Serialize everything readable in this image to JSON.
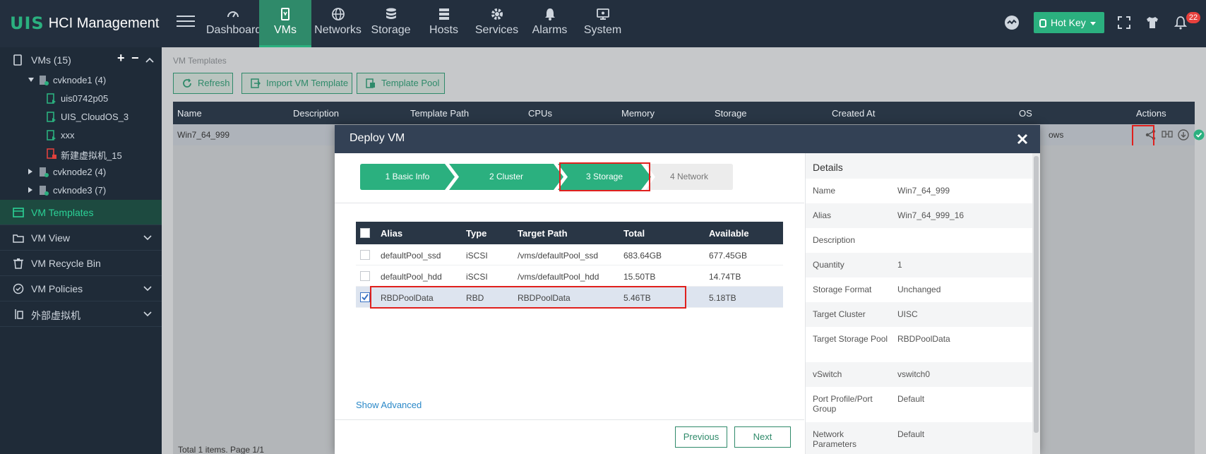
{
  "app": {
    "logo_mark": "UIS",
    "title": "HCI Management"
  },
  "nav": [
    {
      "label": "Dashboard",
      "icon": "gauge-icon"
    },
    {
      "label": "VMs",
      "icon": "vm-icon",
      "active": true
    },
    {
      "label": "Networks",
      "icon": "globe-icon"
    },
    {
      "label": "Storage",
      "icon": "database-icon"
    },
    {
      "label": "Hosts",
      "icon": "server-icon"
    },
    {
      "label": "Services",
      "icon": "gear-icon"
    },
    {
      "label": "Alarms",
      "icon": "bell-icon"
    },
    {
      "label": "System",
      "icon": "monitor-icon"
    }
  ],
  "topright": {
    "hotkey": "Hot Key",
    "notifications": "22"
  },
  "sidebar": {
    "head": "VMs (15)",
    "tree": [
      {
        "label": "cvknode1 (4)",
        "type": "host"
      },
      {
        "label": "uis0742p05",
        "type": "vm-running"
      },
      {
        "label": "UIS_CloudOS_3",
        "type": "vm-running"
      },
      {
        "label": "xxx",
        "type": "vm-running"
      },
      {
        "label": "新建虚拟机_15",
        "type": "vm-stopped"
      },
      {
        "label": "cvknode2 (4)",
        "type": "host"
      },
      {
        "label": "cvknode3 (7)",
        "type": "host"
      }
    ],
    "sections": [
      {
        "label": "VM Templates",
        "active": true
      },
      {
        "label": "VM View"
      },
      {
        "label": "VM Recycle Bin"
      },
      {
        "label": "VM Policies"
      },
      {
        "label": "外部虚拟机"
      }
    ]
  },
  "content": {
    "breadcrumb": "VM Templates",
    "toolbar": {
      "refresh": "Refresh",
      "import": "Import VM Template",
      "pool": "Template Pool"
    },
    "columns": [
      "Name",
      "Description",
      "Template Path",
      "CPUs",
      "Memory",
      "Storage",
      "Created At",
      "OS",
      "Actions"
    ],
    "row": {
      "name": "Win7_64_999",
      "os": "ows"
    },
    "footer": "Total 1 items. Page 1/1"
  },
  "modal": {
    "title": "Deploy VM",
    "steps": [
      "1 Basic Info",
      "2 Cluster",
      "3 Storage",
      "4 Network"
    ],
    "table": {
      "columns": [
        "Alias",
        "Type",
        "Target Path",
        "Total",
        "Available"
      ],
      "rows": [
        {
          "alias": "defaultPool_ssd",
          "type": "iSCSI",
          "path": "/vms/defaultPool_ssd",
          "total": "683.64GB",
          "available": "677.45GB",
          "checked": false
        },
        {
          "alias": "defaultPool_hdd",
          "type": "iSCSI",
          "path": "/vms/defaultPool_hdd",
          "total": "15.50TB",
          "available": "14.74TB",
          "checked": false
        },
        {
          "alias": "RBDPoolData",
          "type": "RBD",
          "path": "RBDPoolData",
          "total": "5.46TB",
          "available": "5.18TB",
          "checked": true
        }
      ]
    },
    "show_advanced": "Show Advanced",
    "previous": "Previous",
    "next": "Next",
    "details": {
      "title": "Details",
      "rows": [
        {
          "k": "Name",
          "v": "Win7_64_999"
        },
        {
          "k": "Alias",
          "v": "Win7_64_999_16"
        },
        {
          "k": "Description",
          "v": ""
        },
        {
          "k": "Quantity",
          "v": "1"
        },
        {
          "k": "Storage Format",
          "v": "Unchanged"
        },
        {
          "k": "Target Cluster",
          "v": "UISC"
        },
        {
          "k": "Target Storage Pool",
          "v": "RBDPoolData"
        },
        {
          "k": "vSwitch",
          "v": "vswitch0"
        },
        {
          "k": "Port Profile/Port Group",
          "v": "Default"
        },
        {
          "k": "Network Parameters",
          "v": "Default"
        }
      ]
    }
  },
  "colors": {
    "accent": "#2bb07f",
    "header": "#232f3e",
    "highlight": "#e0201d"
  }
}
